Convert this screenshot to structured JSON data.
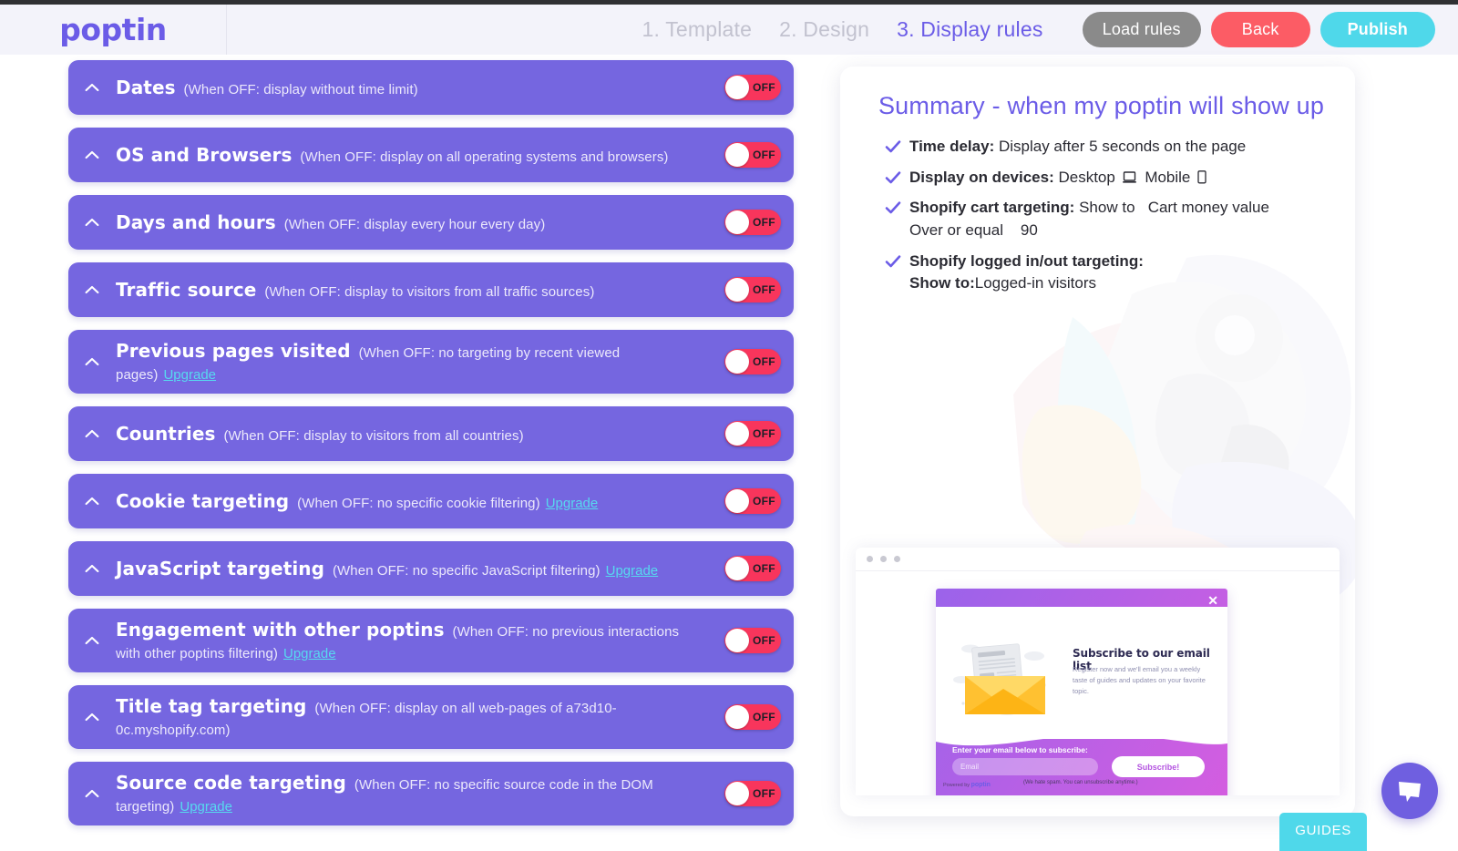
{
  "header": {
    "logo": "poptin",
    "logo_icon": "poptin-logo",
    "steps": [
      {
        "label": "1. Template",
        "active": false
      },
      {
        "label": "2. Design",
        "active": false
      },
      {
        "label": "3. Display rules",
        "active": true
      }
    ],
    "buttons": {
      "load_rules": "Load rules",
      "back": "Back",
      "publish": "Publish"
    },
    "colors": {
      "brand_purple": "#6b5ce7",
      "load_gray": "#8a8a8a",
      "back_red": "#fc5c65",
      "publish_cyan": "#4fd8ea",
      "header_bg": "#f3f3fa"
    }
  },
  "rules": [
    {
      "title": "Dates",
      "desc": "(When OFF: display without time limit)",
      "upgrade": "",
      "toggle": "OFF"
    },
    {
      "title": "OS and Browsers",
      "desc": "(When OFF: display on all operating systems and browsers)",
      "upgrade": "",
      "toggle": "OFF"
    },
    {
      "title": "Days and hours",
      "desc": "(When OFF: display every hour every day)",
      "upgrade": "",
      "toggle": "OFF"
    },
    {
      "title": "Traffic source",
      "desc": "(When OFF: display to visitors from all traffic sources)",
      "upgrade": "",
      "toggle": "OFF"
    },
    {
      "title": "Previous pages visited",
      "desc": "(When OFF: no targeting by recent viewed pages)",
      "upgrade": "Upgrade",
      "toggle": "OFF"
    },
    {
      "title": "Countries",
      "desc": "(When OFF: display to visitors from all countries)",
      "upgrade": "",
      "toggle": "OFF"
    },
    {
      "title": "Cookie targeting",
      "desc": "(When OFF: no specific cookie filtering)",
      "upgrade": "Upgrade",
      "toggle": "OFF"
    },
    {
      "title": "JavaScript targeting",
      "desc": "(When OFF: no specific JavaScript filtering)",
      "upgrade": "Upgrade",
      "toggle": "OFF"
    },
    {
      "title": "Engagement with other poptins",
      "desc": "(When OFF: no previous interactions with other poptins filtering)",
      "upgrade": "Upgrade",
      "toggle": "OFF"
    },
    {
      "title": "Title tag targeting",
      "desc": "(When OFF: display on all web-pages of a73d10-0c.myshopify.com)",
      "upgrade": "",
      "toggle": "OFF"
    },
    {
      "title": "Source code targeting",
      "desc": "(When OFF: no specific source code in the DOM targeting)",
      "upgrade": "Upgrade",
      "toggle": "OFF"
    }
  ],
  "rule_colors": {
    "row_bg": "#7566e0",
    "toggle_off_bg": "#f8355c",
    "upgrade_link": "#57d9ef"
  },
  "summary": {
    "title": "Summary - when my poptin will show up",
    "items": [
      {
        "label": "Time delay:",
        "value": "Display after 5 seconds on the page",
        "sub": ""
      },
      {
        "label": "Display on devices:",
        "value": "Desktop",
        "value2": "Mobile",
        "sub": "",
        "icons": [
          "desktop-icon",
          "mobile-icon"
        ]
      },
      {
        "label": "Shopify cart targeting:",
        "value": "Show to   Cart money value",
        "sub": "Over or equal    90"
      },
      {
        "label": "Shopify logged in/out targeting:",
        "value": "",
        "sub_label": "Show to:",
        "sub_value": "Logged-in visitors"
      }
    ]
  },
  "preview": {
    "popup": {
      "close": "✕",
      "heading": "Subscribe to our email list",
      "subtext": "Register now and we'll email you a weekly taste of guides and updates on your favorite topic.",
      "form_label": "Enter your email below to subscribe:",
      "input_placeholder": "Email",
      "button": "Subscribe!",
      "spam_note": "(We hate spam. You can unsubscribe anytime.)",
      "powered_prefix": "Powered by",
      "powered_brand": "poptin"
    }
  },
  "widgets": {
    "guides": "GUIDES",
    "chat_icon": "chat-bubble-icon"
  }
}
